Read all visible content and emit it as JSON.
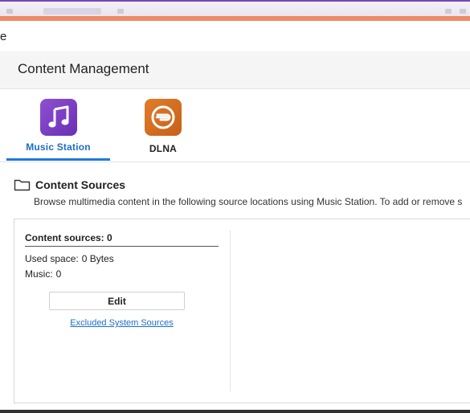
{
  "window": {
    "title": "e"
  },
  "header": {
    "title": "Content Management"
  },
  "tabs": [
    {
      "label": "Music Station",
      "icon": "music-note-icon",
      "active": true,
      "color": "#7b3fc4"
    },
    {
      "label": "DLNA",
      "icon": "dlna-icon",
      "active": false,
      "color": "#d36d22"
    }
  ],
  "section": {
    "title": "Content Sources",
    "description": "Browse multimedia content in the following source locations using Music Station. To add or remove s"
  },
  "panel": {
    "sources_label": "Content sources: 0",
    "used_space_label": "Used space:",
    "used_space_value": "0 Bytes",
    "music_label": "Music:",
    "music_value": "0",
    "edit_button": "Edit",
    "excluded_link": "Excluded System Sources"
  },
  "colors": {
    "accent_purple": "#7a44b5",
    "accent_orange": "#ef8a66",
    "link_blue": "#1d6ec7"
  }
}
